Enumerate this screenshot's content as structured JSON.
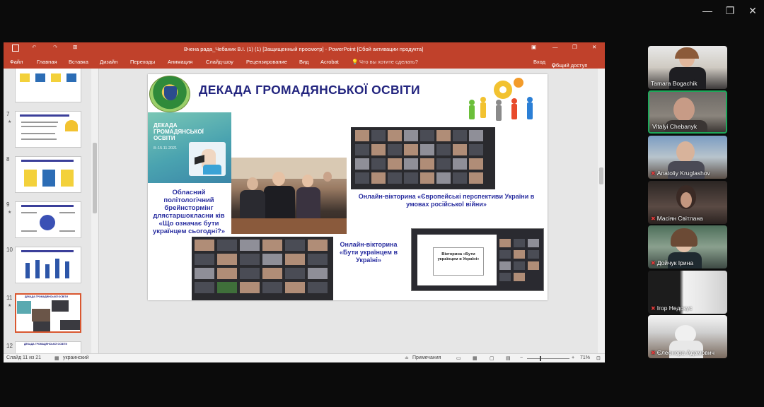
{
  "host_window": {
    "controls": [
      "—",
      "❐",
      "✕"
    ]
  },
  "ppt": {
    "title": "Вчена рада_Чебаник В.І. (1) (1) [Защищенный просмотр] - PowerPoint [Сбой активации продукта]",
    "tabs": [
      "Файл",
      "Главная",
      "Вставка",
      "Дизайн",
      "Переходы",
      "Анимация",
      "Слайд-шоу",
      "Рецензирование",
      "Вид",
      "Acrobat"
    ],
    "tell_me": "Что вы хотите сделать?",
    "login": "Вход",
    "share": "Общий доступ",
    "thumbnails": [
      {
        "num": "7",
        "title": "Вчена рада"
      },
      {
        "num": "8",
        "title": ""
      },
      {
        "num": "9",
        "title": ""
      },
      {
        "num": "10",
        "title": ""
      },
      {
        "num": "11",
        "title": "ДЕКАДА ГРОМАДЯНСЬКОЇ ОСВІТИ"
      },
      {
        "num": "12",
        "title": "ДЕКАДА ГРОМАДЯНСЬКОЇ ОСВІТИ"
      }
    ],
    "slide": {
      "title": "ДЕКАДА ГРОМАДЯНСЬКОЇ ОСВІТИ",
      "card_title": "ДЕКАДА ГРОМАДЯНСЬКОЇ ОСВІТИ",
      "card_date": "8–15.11.2021",
      "text_left": "Обласний політологічний брейнстормінг дляcтаршокласни ків «Що означає бути українцем сьогодні?»",
      "text_right_top": "Онлайн-вікторина «Європейські перспективи України в умовах російської війни»",
      "text_right_bottom": "Онлайн-вікторина «Бути українцем в Україні»",
      "quiz_label": "Вікторина «Бути українцем в Україні»"
    },
    "status": {
      "slide_info": "Слайд 11 из 21",
      "language": "украинский",
      "notes": "Примечания",
      "zoom": "71%"
    }
  },
  "participants": [
    {
      "name": "Tamara Bogachik",
      "muted": false,
      "active": false
    },
    {
      "name": "Vitalyi Chebanyk",
      "muted": false,
      "active": true
    },
    {
      "name": "Anatoliy Kruglashov",
      "muted": true,
      "active": false
    },
    {
      "name": "Масіян Світлана",
      "muted": true,
      "active": false
    },
    {
      "name": "Дойчук Ірина",
      "muted": true,
      "active": false
    },
    {
      "name": "Ігор Недокус",
      "muted": true,
      "active": false
    },
    {
      "name": "Єлеонора Адамович",
      "muted": true,
      "active": false
    }
  ]
}
